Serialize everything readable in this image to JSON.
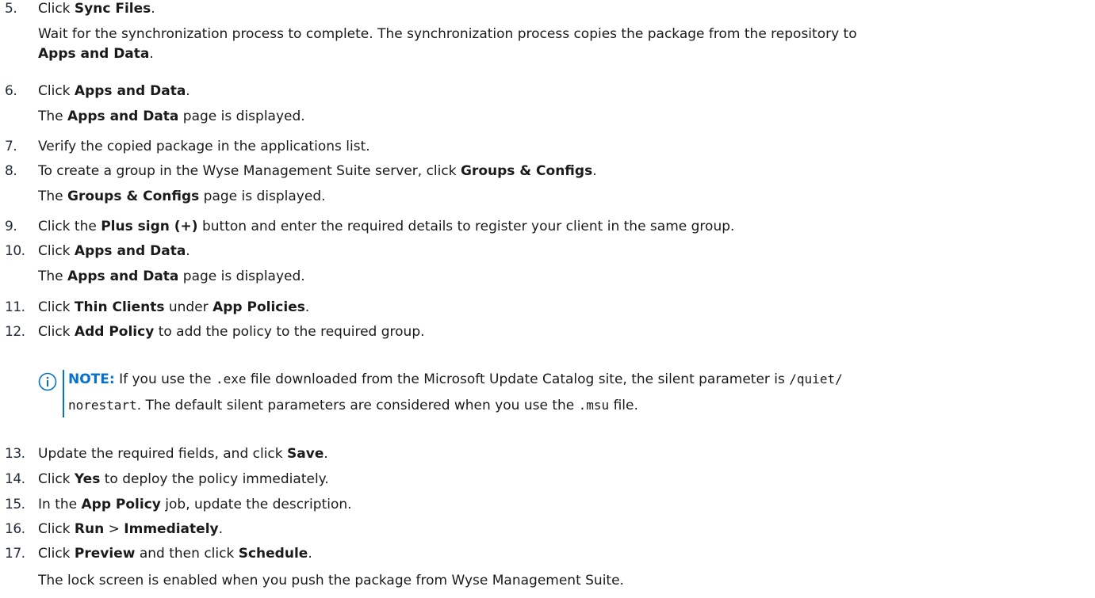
{
  "steps": [
    {
      "num": "5.",
      "parts": [
        [
          "Click ",
          false
        ],
        [
          "Sync Files",
          true
        ],
        [
          ".",
          false
        ]
      ],
      "extra": [
        [
          [
            "Wait for the synchronization process to complete. The synchronization process copies the package from the repository to",
            false
          ]
        ],
        [
          [
            "Apps and Data",
            true
          ],
          [
            ".",
            false
          ]
        ]
      ]
    },
    {
      "num": "6.",
      "parts": [
        [
          "Click ",
          false
        ],
        [
          "Apps and Data",
          true
        ],
        [
          ".",
          false
        ]
      ],
      "extra": [
        [
          [
            "The ",
            false
          ],
          [
            "Apps and Data",
            true
          ],
          [
            " page is displayed.",
            false
          ]
        ]
      ]
    },
    {
      "num": "7.",
      "parts": [
        [
          "Verify the copied package in the applications list.",
          false
        ]
      ],
      "extra": []
    },
    {
      "num": "8.",
      "parts": [
        [
          "To create a group in the Wyse Management Suite server, click ",
          false
        ],
        [
          "Groups & Configs",
          true
        ],
        [
          ".",
          false
        ]
      ],
      "extra": [
        [
          [
            "The ",
            false
          ],
          [
            "Groups & Configs",
            true
          ],
          [
            " page is displayed.",
            false
          ]
        ]
      ]
    },
    {
      "num": "9.",
      "parts": [
        [
          "Click the ",
          false
        ],
        [
          "Plus sign (+)",
          true
        ],
        [
          " button and enter the required details to register your client in the same group.",
          false
        ]
      ],
      "extra": []
    },
    {
      "num": "10.",
      "parts": [
        [
          "Click ",
          false
        ],
        [
          "Apps and Data",
          true
        ],
        [
          ".",
          false
        ]
      ],
      "extra": [
        [
          [
            "The ",
            false
          ],
          [
            "Apps and Data",
            true
          ],
          [
            " page is displayed.",
            false
          ]
        ]
      ]
    },
    {
      "num": "11.",
      "parts": [
        [
          "Click ",
          false
        ],
        [
          "Thin Clients",
          true
        ],
        [
          " under ",
          false
        ],
        [
          "App Policies",
          true
        ],
        [
          ".",
          false
        ]
      ],
      "extra": []
    },
    {
      "num": "12.",
      "parts": [
        [
          "Click ",
          false
        ],
        [
          "Add Policy",
          true
        ],
        [
          " to add the policy to the required group.",
          false
        ]
      ],
      "extra": []
    },
    {
      "num": "13.",
      "parts": [
        [
          "Update the required fields, and click ",
          false
        ],
        [
          "Save",
          true
        ],
        [
          ".",
          false
        ]
      ],
      "extra": []
    },
    {
      "num": "14.",
      "parts": [
        [
          "Click ",
          false
        ],
        [
          "Yes",
          true
        ],
        [
          " to deploy the policy immediately.",
          false
        ]
      ],
      "extra": []
    },
    {
      "num": "15.",
      "parts": [
        [
          "In the ",
          false
        ],
        [
          "App Policy",
          true
        ],
        [
          " job, update the description.",
          false
        ]
      ],
      "extra": []
    },
    {
      "num": "16.",
      "parts": [
        [
          "Click ",
          false
        ],
        [
          "Run",
          true
        ],
        [
          " > ",
          false
        ],
        [
          "Immediately",
          true
        ],
        [
          ".",
          false
        ]
      ],
      "extra": []
    },
    {
      "num": "17.",
      "parts": [
        [
          "Click ",
          false
        ],
        [
          "Preview",
          true
        ],
        [
          " and then click ",
          false
        ],
        [
          "Schedule",
          true
        ],
        [
          ".",
          false
        ]
      ],
      "extra": []
    }
  ],
  "note": {
    "label": "NOTE:",
    "line1_a": " If you use the ",
    "line1_code1": ".exe",
    "line1_b": " file downloaded from the Microsoft Update Catalog site, the silent parameter is ",
    "line1_code2": "/quiet/",
    "line2_code": "norestart",
    "line2_a": ". The default silent parameters are considered when you use the ",
    "line2_code2": ".msu",
    "line2_b": " file."
  },
  "closing": "The lock screen is enabled when you push the package from Wyse Management Suite.",
  "colors": {
    "accent": "#0672cb",
    "text": "#1a1a1a"
  },
  "icons": {
    "note": "info-circle-icon"
  }
}
